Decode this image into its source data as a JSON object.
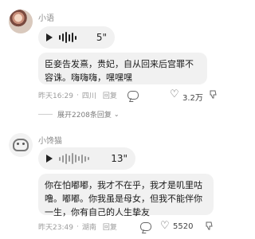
{
  "comments": [
    {
      "username": "小语",
      "voice_duration": "5\"",
      "text": "臣妾告发熹，贵妃，自从回来后宫罪不容诛。嗨嗨嗨，嘿嘿嘿",
      "time": "昨天16:29",
      "location": "四川",
      "reply_label": "回复",
      "likes": "3.2万"
    },
    {
      "username": "小馋猫",
      "voice_duration": "13\"",
      "text": "你在怕嘟嘟，我才不在乎，我才是叽里咕噜。嘟嘟。你我虽是母女，但我不能伴你一生，你有自己的人生挚友",
      "time": "昨天23:49",
      "location": "湖南",
      "reply_label": "回复",
      "likes": "5520"
    }
  ],
  "expand_replies": "展开2208条回复",
  "icons": {
    "play": "play-icon",
    "comment": "comment-icon",
    "like": "heart-icon",
    "dislike": "dislike-icon",
    "expand": "chevron-down-icon"
  }
}
